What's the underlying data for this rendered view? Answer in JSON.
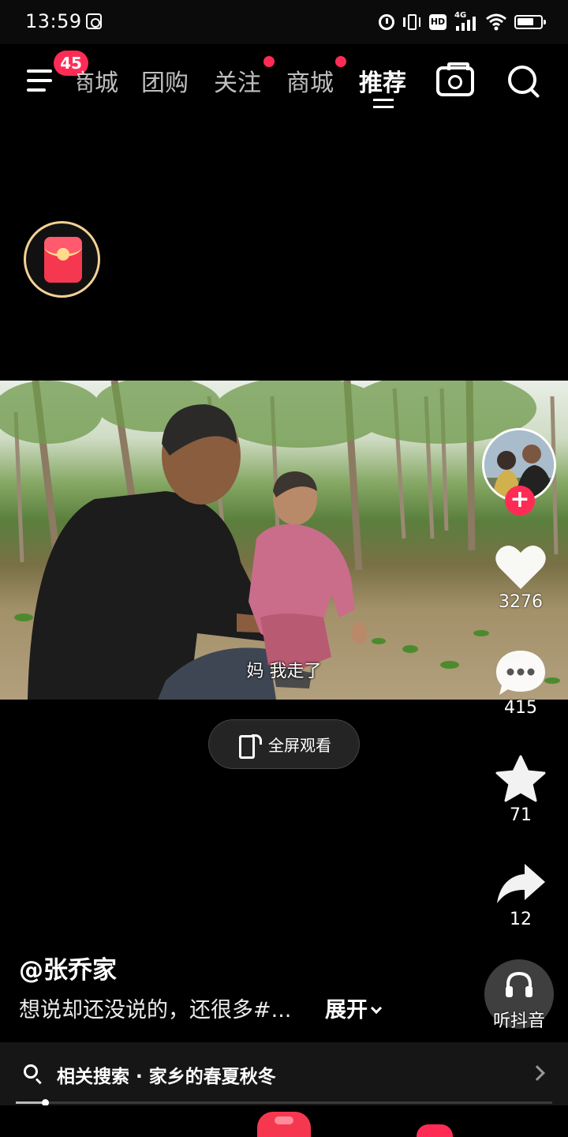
{
  "status_bar": {
    "time": "13:59",
    "icons": [
      "app-notification-icon",
      "alarm-icon",
      "vibrate-icon",
      "hd-icon",
      "signal-4g-icon",
      "wifi-icon",
      "battery-icon"
    ],
    "hd_label": "HD",
    "network_label": "4G"
  },
  "top_nav": {
    "menu_badge": "45",
    "tabs": [
      {
        "label": "商城",
        "dot": false
      },
      {
        "label": "团购",
        "dot": false
      },
      {
        "label": "关注",
        "dot": true
      },
      {
        "label": "商城",
        "dot": true
      },
      {
        "label": "推荐",
        "dot": false,
        "active": true
      }
    ],
    "accent_color": "#fe2c55"
  },
  "video": {
    "subtitle": "妈  我走了",
    "fullscreen_label": "全屏观看"
  },
  "actions": {
    "likes": "3276",
    "comments": "415",
    "favorites": "71",
    "shares": "12",
    "follow_symbol": "+"
  },
  "listen": {
    "label": "听抖音"
  },
  "caption": {
    "author": "@张乔家",
    "description": "想说却还没说的，还很多#...",
    "expand_label": "展开"
  },
  "related_search": {
    "text": "相关搜索 · 家乡的春夏秋冬"
  },
  "progress": {
    "fraction": 0.055
  }
}
